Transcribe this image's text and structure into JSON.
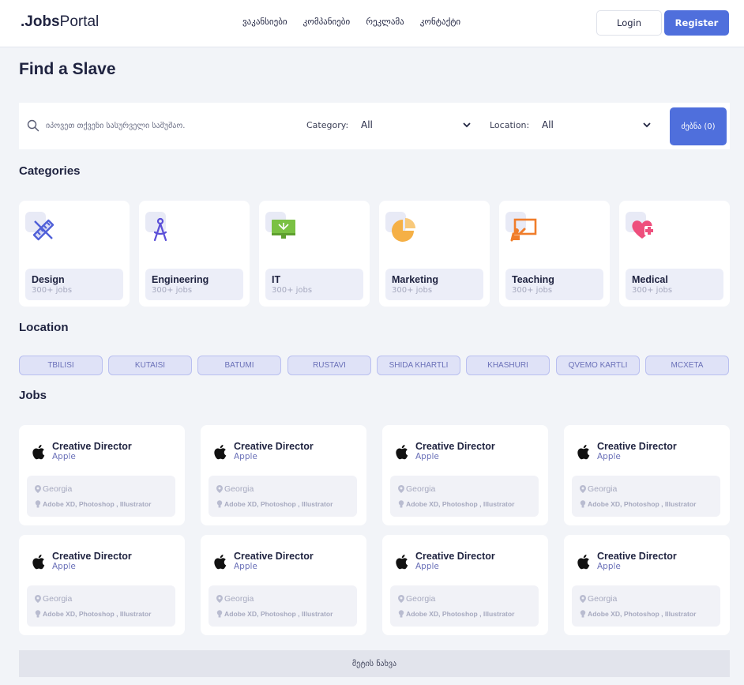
{
  "header": {
    "logo_dot": ".",
    "logo_bold": "Jobs",
    "logo_light": "Portal",
    "nav": [
      "ვაკანსიები",
      "კომპანიები",
      "რეკლამა",
      "კონტაქტი"
    ],
    "login_label": "Login",
    "register_label": "Register"
  },
  "page_title": "Find a Slave",
  "search": {
    "placeholder": "იპოვეთ თქვენი სასურველი სამუშაო.",
    "category_label": "Category:",
    "category_value": "All",
    "location_label": "Location:",
    "location_value": "All",
    "button_label": "ძებნა (0)"
  },
  "categories": {
    "title": "Categories",
    "items": [
      {
        "name": "Design",
        "count": "300+ jobs",
        "icon": "design-ruler-pencil-icon",
        "color": "#4f5fd8"
      },
      {
        "name": "Engineering",
        "count": "300+ jobs",
        "icon": "compass-icon",
        "color": "#5b4fd8"
      },
      {
        "name": "IT",
        "count": "300+ jobs",
        "icon": "monitor-icon",
        "color": "#7ac143"
      },
      {
        "name": "Marketing",
        "count": "300+ jobs",
        "icon": "pie-chart-icon",
        "color": "#f5b046"
      },
      {
        "name": "Teaching",
        "count": "300+ jobs",
        "icon": "teacher-board-icon",
        "color": "#f07d2b"
      },
      {
        "name": "Medical",
        "count": "300+ jobs",
        "icon": "heart-plus-icon",
        "color": "#ee4f7d"
      }
    ]
  },
  "location": {
    "title": "Location",
    "chips": [
      "TBILISI",
      "KUTAISI",
      "BATUMI",
      "RUSTAVI",
      "SHIDA KHARTLI",
      "KHASHURI",
      "QVEMO KARTLI",
      "MCXETA"
    ]
  },
  "jobs": {
    "title": "Jobs",
    "items": [
      {
        "title": "Creative Director",
        "company": "Apple",
        "location": "Georgia",
        "skills": "Adobe XD, Photoshop , Illustrator"
      },
      {
        "title": "Creative Director",
        "company": "Apple",
        "location": "Georgia",
        "skills": "Adobe XD, Photoshop , Illustrator"
      },
      {
        "title": "Creative Director",
        "company": "Apple",
        "location": "Georgia",
        "skills": "Adobe XD, Photoshop , Illustrator"
      },
      {
        "title": "Creative Director",
        "company": "Apple",
        "location": "Georgia",
        "skills": "Adobe XD, Photoshop , Illustrator"
      },
      {
        "title": "Creative Director",
        "company": "Apple",
        "location": "Georgia",
        "skills": "Adobe XD, Photoshop , Illustrator"
      },
      {
        "title": "Creative Director",
        "company": "Apple",
        "location": "Georgia",
        "skills": "Adobe XD, Photoshop , Illustrator"
      },
      {
        "title": "Creative Director",
        "company": "Apple",
        "location": "Georgia",
        "skills": "Adobe XD, Photoshop , Illustrator"
      },
      {
        "title": "Creative Director",
        "company": "Apple",
        "location": "Georgia",
        "skills": "Adobe XD, Photoshop , Illustrator"
      }
    ]
  },
  "load_more_label": "მეტის ნახვა",
  "colors": {
    "accent": "#4f6fdc",
    "background": "#f2f4f8",
    "chip_bg": "#dfe2f7",
    "chip_text": "#6a70b8"
  }
}
